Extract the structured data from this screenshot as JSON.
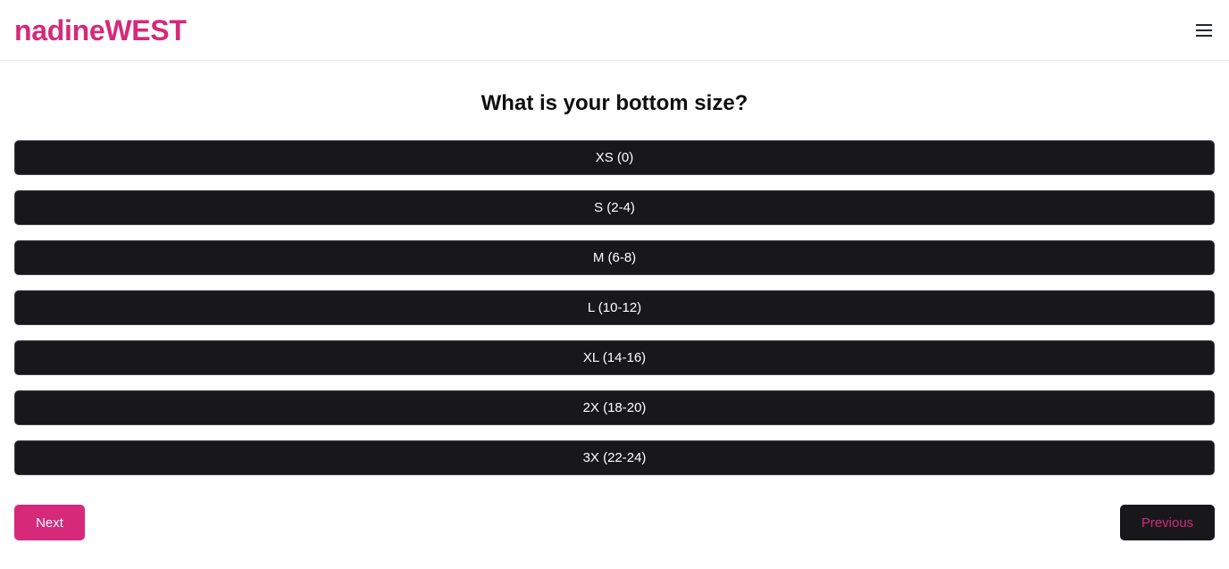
{
  "header": {
    "logo": "nadineWEST",
    "menu_icon": "hamburger-menu-icon"
  },
  "question": {
    "title": "What is your bottom size?"
  },
  "options": [
    {
      "label": "XS (0)"
    },
    {
      "label": "S (2-4)"
    },
    {
      "label": "M (6-8)"
    },
    {
      "label": "L (10-12)"
    },
    {
      "label": "XL (14-16)"
    },
    {
      "label": "2X (18-20)"
    },
    {
      "label": "3X (22-24)"
    }
  ],
  "navigation": {
    "next_label": "Next",
    "previous_label": "Previous"
  },
  "colors": {
    "brand": "#d6297a",
    "option_bg": "#18181b",
    "text_dark": "#0f0f10"
  }
}
